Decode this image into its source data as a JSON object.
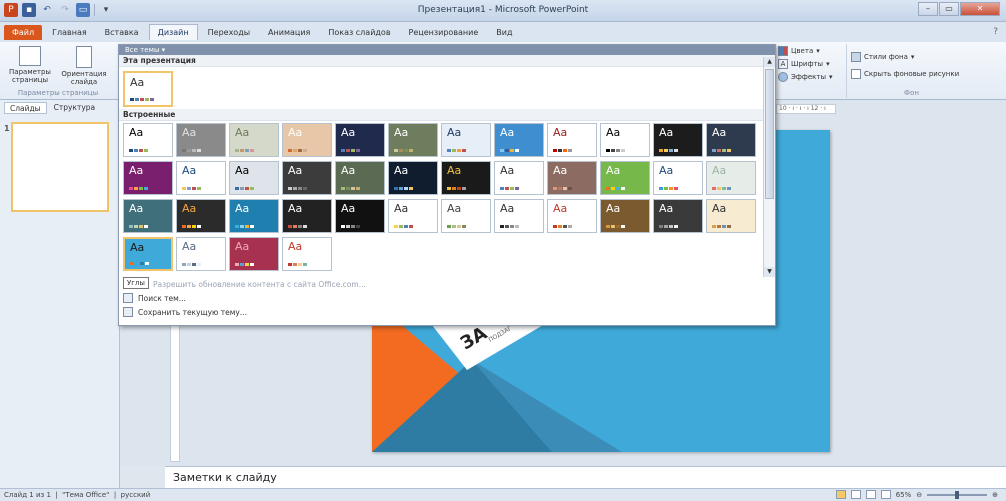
{
  "window": {
    "title": "Презентация1 - Microsoft PowerPoint",
    "help": "?"
  },
  "tabs": [
    "Файл",
    "Главная",
    "Вставка",
    "Дизайн",
    "Переходы",
    "Анимация",
    "Показ слайдов",
    "Рецензирование",
    "Вид"
  ],
  "ribbon": {
    "page_setup": {
      "btn1": "Параметры страницы",
      "btn2": "Ориентация слайда",
      "group": "Параметры страницы"
    },
    "theme_opts": {
      "colors": "Цвета",
      "fonts": "Шрифты",
      "effects": "Эффекты"
    },
    "background": {
      "styles": "Стили фона",
      "hide": "Скрыть фоновые рисунки",
      "group": "Фон"
    }
  },
  "left_pane": {
    "tab1": "Слайды",
    "tab2": "Структура",
    "slide_number": "1"
  },
  "ruler_label": "10 · ı · ı · ı 12 · ı",
  "slide": {
    "title_fragment": "ЗА",
    "subtitle_fragment": "ПОДЗАГ"
  },
  "dropdown": {
    "header": "Все темы",
    "this_presentation": "Эта презентация",
    "current_theme_label": "Aa",
    "builtin": "Встроенные",
    "tooltip": "Углы",
    "links": [
      "Разрешить обновление контента с сайта Office.com...",
      "Поиск тем...",
      "Сохранить текущую тему..."
    ]
  },
  "themes": [
    {
      "label": "Aa",
      "bg": "#ffffff",
      "fg": "#000000",
      "c": [
        "#1f497d",
        "#4f81bd",
        "#c0504d",
        "#9bbb59"
      ]
    },
    {
      "label": "Aa",
      "bg": "#8a8a8a",
      "fg": "#e0e0e0",
      "c": [
        "#777",
        "#999",
        "#bbb",
        "#ddd"
      ]
    },
    {
      "label": "Aa",
      "bg": "#d4d9c9",
      "fg": "#6f7a5e",
      "c": [
        "#a5b592",
        "#c3986d",
        "#7b9fb8",
        "#d99694"
      ]
    },
    {
      "label": "Aa",
      "bg": "#e8c7a8",
      "fg": "#ffffff",
      "c": [
        "#d26a2b",
        "#e0a36a",
        "#9c6a3f",
        "#c9b097"
      ]
    },
    {
      "label": "Aa",
      "bg": "#1f2a4d",
      "fg": "#ffffff",
      "c": [
        "#4f81bd",
        "#c0504d",
        "#9bbb59",
        "#8064a2"
      ]
    },
    {
      "label": "Aa",
      "bg": "#6e7d5e",
      "fg": "#ffffff",
      "c": [
        "#d3c59f",
        "#a88e58",
        "#7e8d5a",
        "#c8b070"
      ]
    },
    {
      "label": "Aa",
      "bg": "#e6eef7",
      "fg": "#1f3a66",
      "c": [
        "#4f81bd",
        "#9bbb59",
        "#f79646",
        "#c0504d"
      ]
    },
    {
      "label": "Aa",
      "bg": "#3e8ed0",
      "fg": "#ffffff",
      "c": [
        "#86c5ef",
        "#2e5b96",
        "#f1b23e",
        "#ffffff"
      ]
    },
    {
      "label": "Aa",
      "bg": "#ffffff",
      "fg": "#9b1b1b",
      "c": [
        "#c00000",
        "#333",
        "#ff6600",
        "#999"
      ]
    },
    {
      "label": "Aa",
      "bg": "#ffffff",
      "fg": "#000000",
      "c": [
        "#000",
        "#444",
        "#888",
        "#ccc"
      ]
    },
    {
      "label": "Aa",
      "bg": "#1c1c1c",
      "fg": "#ffffff",
      "c": [
        "#f0a030",
        "#f0d060",
        "#80b0e0",
        "#e0e0e0"
      ]
    },
    {
      "label": "Aa",
      "bg": "#2e3b4e",
      "fg": "#ffffff",
      "c": [
        "#7fa1c7",
        "#cf6b6b",
        "#a3c37a",
        "#f2c46a"
      ]
    },
    {
      "label": "Aa",
      "bg": "#7a1f6d",
      "fg": "#ffffff",
      "c": [
        "#e64c9c",
        "#f7a63f",
        "#7bbf3c",
        "#49a6e0"
      ]
    },
    {
      "label": "Aa",
      "bg": "#ffffff",
      "fg": "#1f497d",
      "c": [
        "#f2c46a",
        "#7fa1c7",
        "#c0504d",
        "#9bbb59"
      ]
    },
    {
      "label": "Aa",
      "bg": "#dfe4ea",
      "fg": "#000000",
      "c": [
        "#3e6c9f",
        "#8a9ab3",
        "#c0504d",
        "#9bbb59"
      ]
    },
    {
      "label": "Aa",
      "bg": "#3c3c3c",
      "fg": "#ffffff",
      "c": [
        "#cfcfcf",
        "#aaaaaa",
        "#888888",
        "#666666"
      ]
    },
    {
      "label": "Aa",
      "bg": "#5b6a52",
      "fg": "#ffffff",
      "c": [
        "#a6b97f",
        "#7e8d5a",
        "#d3c59f",
        "#c8b070"
      ]
    },
    {
      "label": "Aa",
      "bg": "#0f1d2f",
      "fg": "#ffffff",
      "c": [
        "#2e75b6",
        "#69a0d7",
        "#b8d4ee",
        "#f2c46a"
      ]
    },
    {
      "label": "Aa",
      "bg": "#1a1a1a",
      "fg": "#f0c040",
      "c": [
        "#f0c040",
        "#e08020",
        "#c04020",
        "#a0a0a0"
      ]
    },
    {
      "label": "Aa",
      "bg": "#ffffff",
      "fg": "#333333",
      "c": [
        "#4f81bd",
        "#c0504d",
        "#9bbb59",
        "#8064a2"
      ]
    },
    {
      "label": "Aa",
      "bg": "#8c6c62",
      "fg": "#ffffff",
      "c": [
        "#d89a7e",
        "#b77a62",
        "#e4c1a8",
        "#6f5048"
      ]
    },
    {
      "label": "Aa",
      "bg": "#76b84a",
      "fg": "#ffffff",
      "c": [
        "#f26b21",
        "#ffd200",
        "#46b1e1",
        "#ffffff"
      ]
    },
    {
      "label": "Aa",
      "bg": "#ffffff",
      "fg": "#1f497d",
      "c": [
        "#3aa0d8",
        "#77c043",
        "#f7941d",
        "#e94e77"
      ]
    },
    {
      "label": "Aa",
      "bg": "#e6ece8",
      "fg": "#9bb3a8",
      "c": [
        "#e06c6c",
        "#f2c46a",
        "#7fb89e",
        "#6d8fb8"
      ]
    },
    {
      "label": "Aa",
      "bg": "#3f6f7a",
      "fg": "#ffffff",
      "c": [
        "#8fc0c8",
        "#c7d5a6",
        "#e2c26a",
        "#ffffff"
      ]
    },
    {
      "label": "Aa",
      "bg": "#2b2b2b",
      "fg": "#f7a63f",
      "c": [
        "#f26b21",
        "#f7a63f",
        "#ffd200",
        "#ffffff"
      ]
    },
    {
      "label": "Aa",
      "bg": "#1f7fae",
      "fg": "#ffffff",
      "c": [
        "#3ab0e0",
        "#8dd2ef",
        "#f1b23e",
        "#ffffff"
      ]
    },
    {
      "label": "Aa",
      "bg": "#222222",
      "fg": "#ffffff",
      "c": [
        "#c94f3c",
        "#e08060",
        "#888888",
        "#dddddd"
      ]
    },
    {
      "label": "Aa",
      "bg": "#111111",
      "fg": "#ffffff",
      "c": [
        "#ffffff",
        "#cccccc",
        "#888888",
        "#444444"
      ]
    },
    {
      "label": "Aa",
      "bg": "#ffffff",
      "fg": "#333333",
      "c": [
        "#f7d24a",
        "#9bbb59",
        "#4f81bd",
        "#c0504d"
      ]
    },
    {
      "label": "Aa",
      "bg": "#ffffff",
      "fg": "#444444",
      "c": [
        "#6f9a52",
        "#a6c27f",
        "#d3c59f",
        "#7e8d5a"
      ]
    },
    {
      "label": "Aa",
      "bg": "#ffffff",
      "fg": "#333333",
      "c": [
        "#222222",
        "#555555",
        "#888888",
        "#bbbbbb"
      ]
    },
    {
      "label": "Aa",
      "bg": "#ffffff",
      "fg": "#c0392b",
      "c": [
        "#c0392b",
        "#e67e22",
        "#555555",
        "#aaaaaa"
      ]
    },
    {
      "label": "Aa",
      "bg": "#7a5a2e",
      "fg": "#ffffff",
      "c": [
        "#d39a3a",
        "#e9c16d",
        "#a06b2a",
        "#ffffff"
      ]
    },
    {
      "label": "Aa",
      "bg": "#3a3a3a",
      "fg": "#ffffff",
      "c": [
        "#7f7f7f",
        "#a5a5a5",
        "#c9c9c9",
        "#f2f2f2"
      ]
    },
    {
      "label": "Aa",
      "bg": "#f7ecd2",
      "fg": "#333333",
      "c": [
        "#d8a24a",
        "#b8783a",
        "#6c8fb8",
        "#8b6f47"
      ]
    },
    {
      "label": "Aa",
      "bg": "#3fa9d9",
      "fg": "#1a1a1a",
      "c": [
        "#f26b21",
        "#3fa9d9",
        "#2e7ca3",
        "#ffffff"
      ]
    },
    {
      "label": "Aa",
      "bg": "#ffffff",
      "fg": "#5c6b7f",
      "c": [
        "#8fa6c1",
        "#c4d0de",
        "#5c6b7f",
        "#e8eef6"
      ]
    },
    {
      "label": "Aa",
      "bg": "#a6324f",
      "fg": "#f0a8b8",
      "c": [
        "#f0a8b8",
        "#5aa0d0",
        "#f7d24a",
        "#ffffff"
      ]
    },
    {
      "label": "Aa",
      "bg": "#ffffff",
      "fg": "#c0392b",
      "c": [
        "#c0392b",
        "#e07a5f",
        "#f2cc8f",
        "#81b29a"
      ]
    }
  ]
}
